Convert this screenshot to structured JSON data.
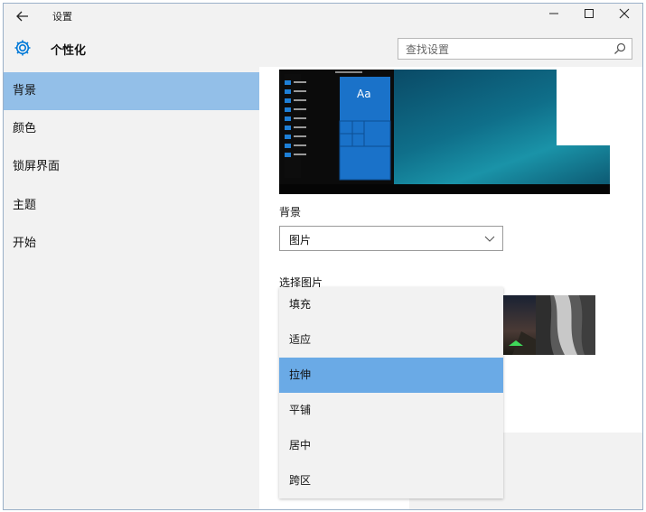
{
  "window": {
    "title": "设置",
    "minimize": "—",
    "maximize": "☐",
    "close": "✕"
  },
  "header": {
    "page_title": "个性化",
    "search_placeholder": "查找设置"
  },
  "sidebar": {
    "items": [
      {
        "label": "背景",
        "active": true
      },
      {
        "label": "颜色",
        "active": false
      },
      {
        "label": "锁屏界面",
        "active": false
      },
      {
        "label": "主题",
        "active": false
      },
      {
        "label": "开始",
        "active": false
      }
    ]
  },
  "preview": {
    "tile_text": "Aa"
  },
  "background": {
    "label": "背景",
    "value": "图片"
  },
  "choose_picture": {
    "label": "选择图片"
  },
  "fit_dropdown": {
    "options": [
      "填充",
      "适应",
      "拉伸",
      "平铺",
      "居中",
      "跨区"
    ],
    "selected": "拉伸"
  },
  "colors": {
    "accent": "#0078d7",
    "sidebar_active": "#93bfe8",
    "option_selected": "#6aaae6",
    "chrome": "#f2f2f2"
  }
}
